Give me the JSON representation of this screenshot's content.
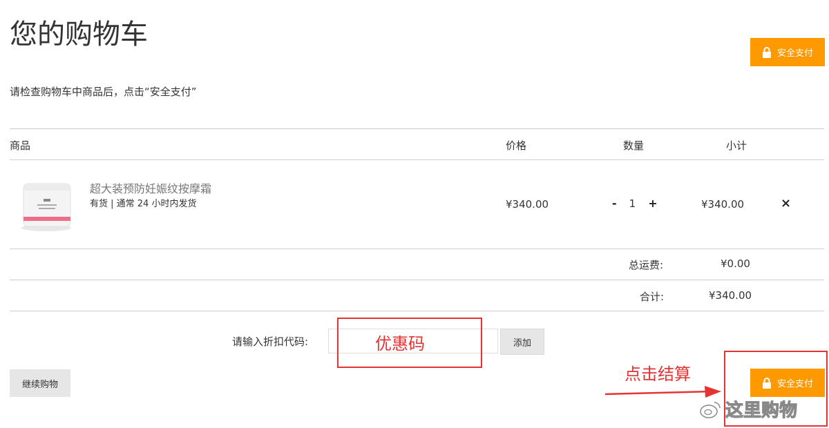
{
  "page": {
    "title": "您的购物车",
    "instructions": "请检查购物车中商品后，点击“安全支付”"
  },
  "buttons": {
    "secure_pay": "安全支付",
    "add": "添加",
    "continue": "继续购物"
  },
  "table": {
    "headers": {
      "product": "商品",
      "price": "价格",
      "quantity": "数量",
      "subtotal": "小计"
    },
    "items": [
      {
        "name": "超大装预防妊娠纹按摩霜",
        "stock": "有货 | 通常 24 小时内发货",
        "price": "¥340.00",
        "quantity": "1",
        "subtotal": "¥340.00",
        "minus": "-",
        "plus": "+",
        "remove": "×"
      }
    ]
  },
  "summary": {
    "shipping_label": "总运费:",
    "shipping_value": "¥0.00",
    "total_label": "合计:",
    "total_value": "¥340.00"
  },
  "coupon": {
    "label": "请输入折扣代码:",
    "value": "",
    "placeholder": ""
  },
  "annotations": {
    "coupon_note": "优惠码",
    "checkout_note": "点击结算"
  },
  "watermark": {
    "text": "这里购物"
  },
  "colors": {
    "accent": "#ff9900",
    "annotation": "#e53333"
  }
}
